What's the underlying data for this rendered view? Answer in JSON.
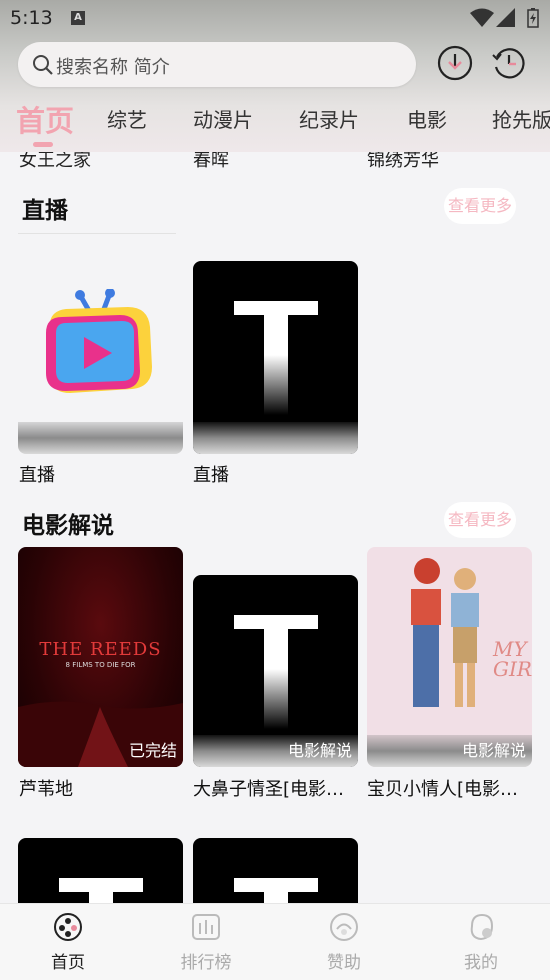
{
  "status_bar": {
    "time": "5:13",
    "notif_icon": "A"
  },
  "search": {
    "placeholder": "搜索名称 简介"
  },
  "header_icons": [
    "download-icon",
    "history-icon"
  ],
  "tabs": [
    "首页",
    "综艺",
    "动漫片",
    "纪录片",
    "电影",
    "抢先版"
  ],
  "active_tab": 0,
  "partial_titles": [
    "女王之家",
    "春晖",
    "锦绣芳华"
  ],
  "sections": [
    {
      "title": "直播",
      "more": "查看更多",
      "items": [
        {
          "label": "直播",
          "badge": "",
          "poster": "tv-logo"
        },
        {
          "label": "直播",
          "badge": "",
          "poster": "t-placeholder"
        }
      ]
    },
    {
      "title": "电影解说",
      "more": "查看更多",
      "items": [
        {
          "label": "芦苇地",
          "badge": "已完结",
          "poster": "the-reeds",
          "poster_title": "THE REEDS",
          "poster_tag": "8 FILMS TO DIE FOR"
        },
        {
          "label": "大鼻子情圣[电影解说]",
          "badge": "电影解说",
          "poster": "t-placeholder"
        },
        {
          "label": "宝贝小情人[电影解说]",
          "badge": "电影解说",
          "poster": "my-girl",
          "poster_title": "MY GIRL"
        }
      ]
    }
  ],
  "bottom_nav": [
    {
      "label": "首页",
      "icon": "film-reel-icon",
      "active": true
    },
    {
      "label": "排行榜",
      "icon": "chart-icon",
      "active": false
    },
    {
      "label": "赞助",
      "icon": "sponsor-icon",
      "active": false
    },
    {
      "label": "我的",
      "icon": "profile-icon",
      "active": false
    }
  ],
  "colors": {
    "accent": "#f2a4b0",
    "more_text": "#f5b8c2"
  }
}
